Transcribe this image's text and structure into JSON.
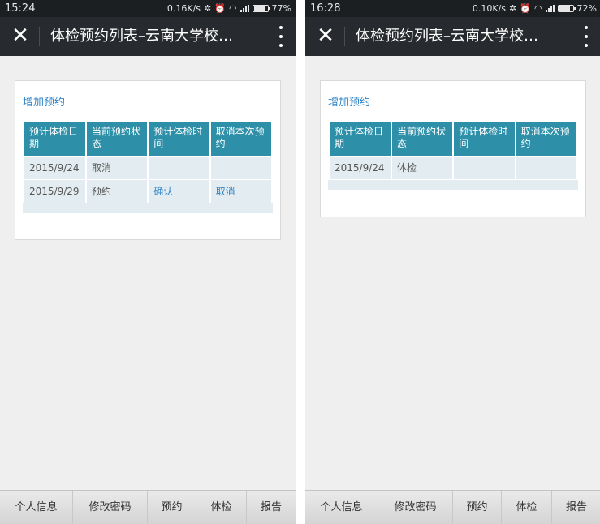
{
  "screens": [
    {
      "status": {
        "time": "15:24",
        "speed": "0.16K/s",
        "battery": "77%",
        "battery_level": 0.77
      },
      "appbar": {
        "title": "体检预约列表–云南大学校…"
      },
      "add_link": "增加预约",
      "table": {
        "headers": [
          "预计体检日期",
          "当前预约状态",
          "预计体检时间",
          "取消本次预约"
        ],
        "rows": [
          [
            "2015/9/24",
            "取消",
            "",
            ""
          ],
          [
            "2015/9/29",
            "预约",
            "确认",
            "取消"
          ]
        ]
      },
      "tabs": [
        "个人信息",
        "修改密码",
        "预约",
        "体检",
        "报告"
      ]
    },
    {
      "status": {
        "time": "16:28",
        "speed": "0.10K/s",
        "battery": "72%",
        "battery_level": 0.72
      },
      "appbar": {
        "title": "体检预约列表–云南大学校…"
      },
      "add_link": "增加预约",
      "table": {
        "headers": [
          "预计体检日期",
          "当前预约状态",
          "预计体检时间",
          "取消本次预约"
        ],
        "rows": [
          [
            "2015/9/24",
            "体检",
            "",
            ""
          ]
        ]
      },
      "tabs": [
        "个人信息",
        "修改密码",
        "预约",
        "体检",
        "报告"
      ]
    }
  ],
  "colors": {
    "header_bg": "#2d8fa8",
    "cell_bg": "#e3edf1",
    "link": "#2f84c8",
    "titlebar": "#272a2e"
  }
}
